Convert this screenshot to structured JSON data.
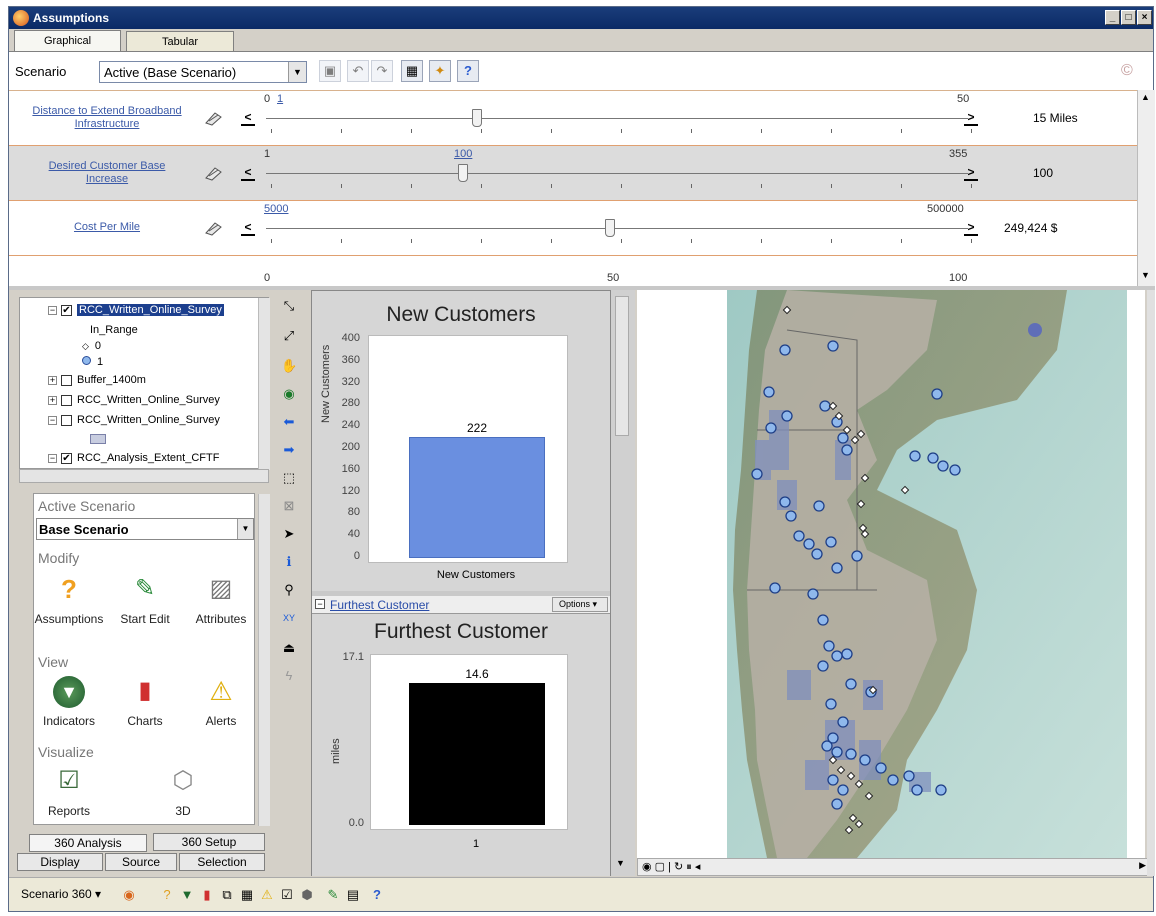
{
  "window": {
    "title": "Assumptions",
    "controls": [
      "_",
      "□",
      "×"
    ]
  },
  "tabs": [
    {
      "label": "Graphical",
      "active": true
    },
    {
      "label": "Tabular",
      "active": false
    }
  ],
  "scenario": {
    "label": "Scenario",
    "selected": "Active (Base Scenario)"
  },
  "sliders": [
    {
      "label": "Distance to Extend Broadband Infrastructure",
      "min": "0",
      "marker": "1",
      "max": "50",
      "value_text": "15  Miles",
      "position": 0.3
    },
    {
      "label": "Desired Customer Base Increase",
      "min": "1",
      "marker": "100",
      "max": "355",
      "value_text": "100",
      "position": 0.28
    },
    {
      "label": "Cost Per Mile",
      "min": "5000",
      "max": "500000",
      "value_text": "249,424  $",
      "position": 0.49
    }
  ],
  "slider_axis": [
    "0",
    "50",
    "100"
  ],
  "layers": [
    {
      "name": "RCC_Written_Online_Survey",
      "checked": true,
      "expanded": true,
      "selected": true
    },
    {
      "name": "In_Range",
      "legend": true
    },
    {
      "name": "0",
      "symbol": "diamond"
    },
    {
      "name": "1",
      "symbol": "circle"
    },
    {
      "name": "Buffer_1400m",
      "checked": false,
      "expanded": false
    },
    {
      "name": "RCC_Written_Online_Survey",
      "checked": false,
      "expanded": false
    },
    {
      "name": "RCC_Written_Online_Survey",
      "checked": false,
      "expanded": true
    },
    {
      "name": "RCC_Analysis_Extent_CFTF",
      "checked": true,
      "expanded": true
    }
  ],
  "active_scenario": {
    "header": "Active Scenario",
    "selected": "Base Scenario"
  },
  "modify": {
    "header": "Modify",
    "items": [
      "Assumptions",
      "Start Edit",
      "Attributes"
    ]
  },
  "view": {
    "header": "View",
    "items": [
      "Indicators",
      "Charts",
      "Alerts"
    ]
  },
  "visualize": {
    "header": "Visualize",
    "items": [
      "Reports",
      "3D"
    ]
  },
  "bottom_tabs_row1": [
    "360 Analysis",
    "360 Setup"
  ],
  "bottom_tabs_row2": [
    "Display",
    "Source",
    "Selection"
  ],
  "charts": [
    {
      "title": "New Customers",
      "ylabel": "New Customers",
      "ticks": [
        "400",
        "360",
        "320",
        "280",
        "240",
        "200",
        "160",
        "120",
        "80",
        "40",
        "0"
      ],
      "category": "New Customers",
      "value": 222,
      "ymax": 400,
      "bar_color": "#6a8fe0"
    },
    {
      "header_link": "Furthest Customer",
      "options": "Options",
      "title": "Furthest Customer",
      "ylabel": "miles",
      "ticks": [
        "17.1",
        "0.0"
      ],
      "category": "1",
      "value": 14.6,
      "ymax": 17.1,
      "bar_color": "#000000"
    }
  ],
  "bottom_toolbar": {
    "label": "Scenario 360"
  },
  "colors": {
    "accent": "#3b5aa8",
    "title_bar": "#0b2a66",
    "divider": "#e0a070"
  }
}
